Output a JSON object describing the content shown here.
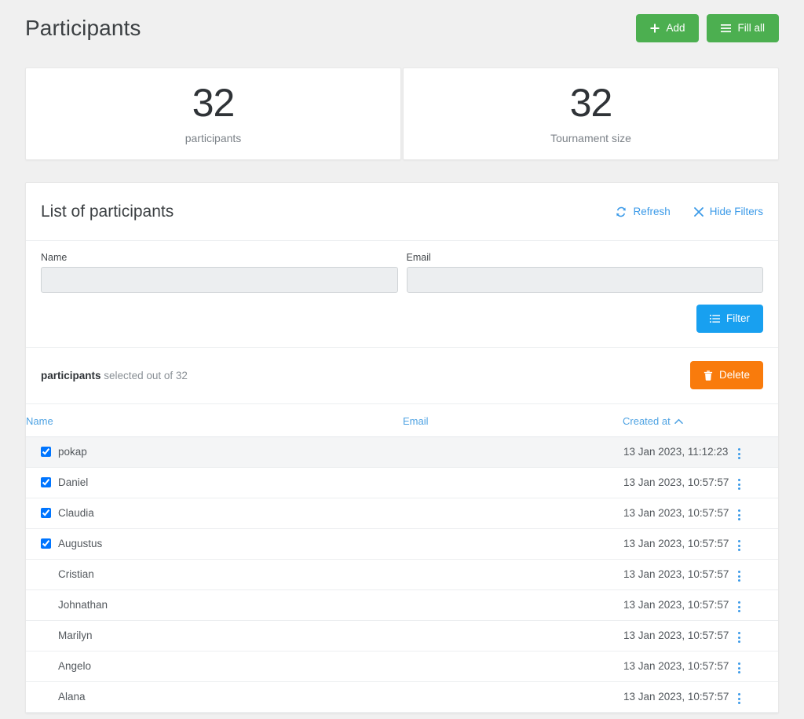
{
  "header": {
    "title": "Participants",
    "add_label": "Add",
    "add_icon": "plus-icon",
    "fill_all_label": "Fill all",
    "fill_all_icon": "list-icon"
  },
  "stats": [
    {
      "value": "32",
      "label": "participants"
    },
    {
      "value": "32",
      "label": "Tournament size"
    }
  ],
  "panel": {
    "title": "List of participants",
    "refresh_label": "Refresh",
    "refresh_icon": "sync-icon",
    "hide_filters_label": "Hide Filters",
    "hide_filters_icon": "close-icon"
  },
  "filters": {
    "name": {
      "label": "Name",
      "value": "",
      "placeholder": ""
    },
    "email": {
      "label": "Email",
      "value": "",
      "placeholder": ""
    },
    "filter_button": "Filter",
    "filter_icon": "list-icon"
  },
  "selection": {
    "count_text": "participants",
    "suffix_text": "selected out of 32",
    "delete_label": "Delete",
    "delete_icon": "trash-icon"
  },
  "table": {
    "columns": {
      "name": "Name",
      "email": "Email",
      "created_at": "Created at",
      "sort_icon": "chevron-up-icon"
    },
    "rows": [
      {
        "checked": true,
        "name": "pokap",
        "email": "",
        "created_at": "13 Jan 2023, 11:12:23",
        "striped": true
      },
      {
        "checked": true,
        "name": "Daniel",
        "email": "",
        "created_at": "13 Jan 2023, 10:57:57",
        "striped": false
      },
      {
        "checked": true,
        "name": "Claudia",
        "email": "",
        "created_at": "13 Jan 2023, 10:57:57",
        "striped": false
      },
      {
        "checked": true,
        "name": "Augustus",
        "email": "",
        "created_at": "13 Jan 2023, 10:57:57",
        "striped": false
      },
      {
        "checked": false,
        "name": "Cristian",
        "email": "",
        "created_at": "13 Jan 2023, 10:57:57",
        "striped": false
      },
      {
        "checked": false,
        "name": "Johnathan",
        "email": "",
        "created_at": "13 Jan 2023, 10:57:57",
        "striped": false
      },
      {
        "checked": false,
        "name": "Marilyn",
        "email": "",
        "created_at": "13 Jan 2023, 10:57:57",
        "striped": false
      },
      {
        "checked": false,
        "name": "Angelo",
        "email": "",
        "created_at": "13 Jan 2023, 10:57:57",
        "striped": false
      },
      {
        "checked": false,
        "name": "Alana",
        "email": "",
        "created_at": "13 Jan 2023, 10:57:57",
        "striped": false
      }
    ]
  },
  "colors": {
    "green": "#4caf50",
    "blue": "#18a0f0",
    "orange": "#f97b0c",
    "link": "#3b9ae8",
    "page_bg": "#f0f0f0"
  }
}
